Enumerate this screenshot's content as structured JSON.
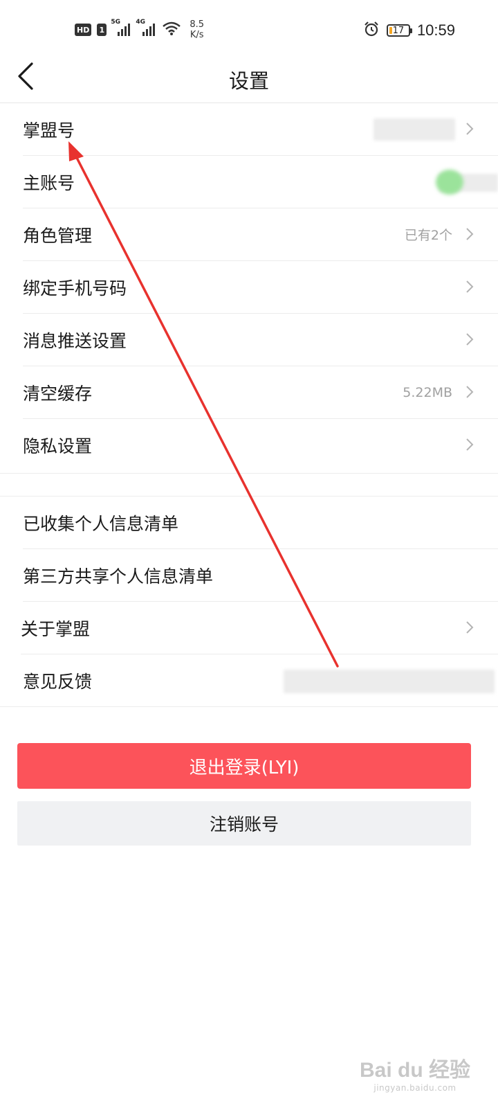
{
  "status_bar": {
    "hd": "HD",
    "sim": "1",
    "net1": "5G",
    "net2": "4G",
    "speed_value": "8.5",
    "speed_unit": "K/s",
    "battery": "17",
    "time": "10:59"
  },
  "nav": {
    "title": "设置"
  },
  "settings_group1": [
    {
      "label": "掌盟号",
      "value": ""
    },
    {
      "label": "主账号",
      "value": ""
    },
    {
      "label": "角色管理",
      "value": "已有2个"
    },
    {
      "label": "绑定手机号码",
      "value": ""
    },
    {
      "label": "消息推送设置",
      "value": ""
    },
    {
      "label": "清空缓存",
      "value": "5.22MB"
    },
    {
      "label": "隐私设置",
      "value": ""
    }
  ],
  "settings_group2": [
    {
      "label": "已收集个人信息清单"
    },
    {
      "label": "第三方共享个人信息清单"
    },
    {
      "label": "关于掌盟"
    },
    {
      "label": "意见反馈"
    }
  ],
  "buttons": {
    "logout": "退出登录(LYI)",
    "cancel_account": "注销账号"
  },
  "colors": {
    "logout_bg": "#fc535a",
    "cancel_bg": "#f0f1f3",
    "annotation_arrow": "#e8322e"
  },
  "watermark": {
    "brand": "Bai du 经验",
    "url": "jingyan.baidu.com"
  }
}
